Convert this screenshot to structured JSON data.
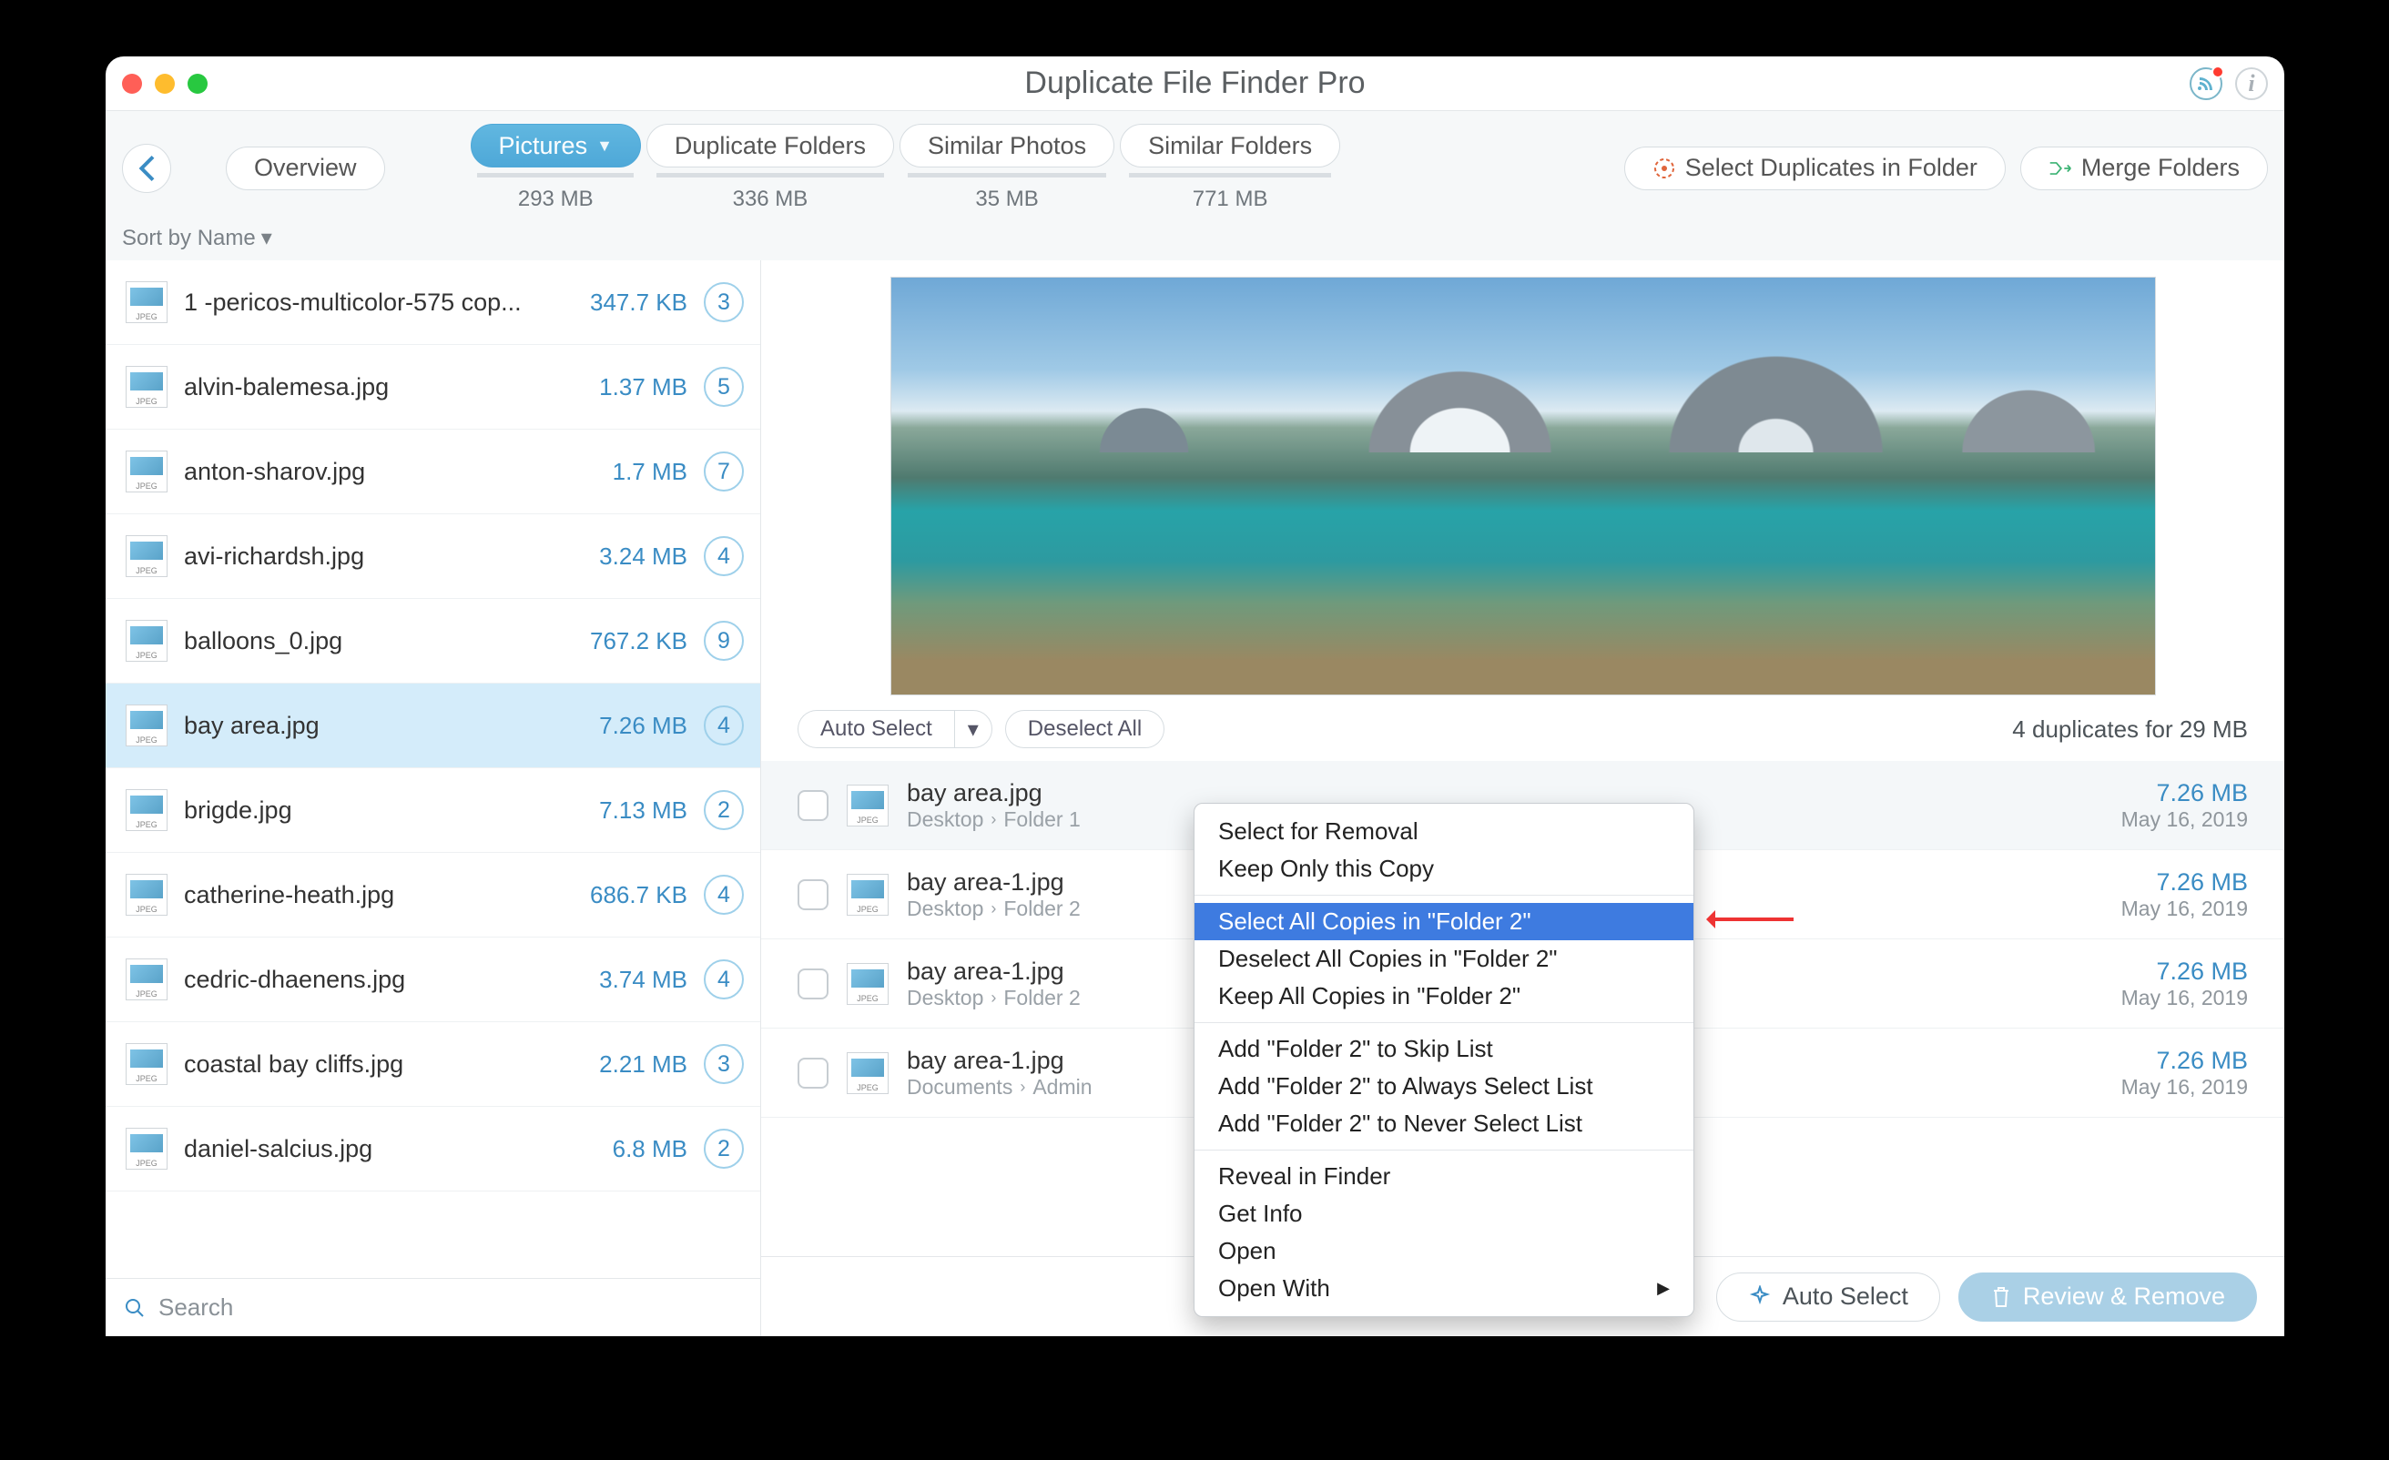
{
  "title": "Duplicate File Finder Pro",
  "toolbar": {
    "overview": "Overview",
    "tabs": [
      {
        "label": "Pictures",
        "size": "293 MB",
        "active": true
      },
      {
        "label": "Duplicate Folders",
        "size": "336 MB",
        "active": false
      },
      {
        "label": "Similar Photos",
        "size": "35 MB",
        "active": false
      },
      {
        "label": "Similar Folders",
        "size": "771 MB",
        "active": false
      }
    ],
    "select_in_folder": "Select Duplicates in Folder",
    "merge_folders": "Merge Folders"
  },
  "sort": {
    "label": "Sort by Name"
  },
  "files": [
    {
      "name": "1 -pericos-multicolor-575 cop...",
      "size": "347.7 KB",
      "count": "3"
    },
    {
      "name": "alvin-balemesa.jpg",
      "size": "1.37 MB",
      "count": "5"
    },
    {
      "name": "anton-sharov.jpg",
      "size": "1.7 MB",
      "count": "7"
    },
    {
      "name": "avi-richardsh.jpg",
      "size": "3.24 MB",
      "count": "4"
    },
    {
      "name": "balloons_0.jpg",
      "size": "767.2 KB",
      "count": "9"
    },
    {
      "name": "bay area.jpg",
      "size": "7.26 MB",
      "count": "4",
      "selected": true
    },
    {
      "name": "brigde.jpg",
      "size": "7.13 MB",
      "count": "2"
    },
    {
      "name": "catherine-heath.jpg",
      "size": "686.7 KB",
      "count": "4"
    },
    {
      "name": "cedric-dhaenens.jpg",
      "size": "3.74 MB",
      "count": "4"
    },
    {
      "name": "coastal bay cliffs.jpg",
      "size": "2.21 MB",
      "count": "3"
    },
    {
      "name": "daniel-salcius.jpg",
      "size": "6.8 MB",
      "count": "2"
    }
  ],
  "search": {
    "placeholder": "Search"
  },
  "detail": {
    "auto_select": "Auto Select",
    "deselect_all": "Deselect All",
    "summary": "4 duplicates for 29 MB",
    "dups": [
      {
        "file": "bay area.jpg",
        "path": [
          "Desktop",
          "Folder 1"
        ],
        "size": "7.26 MB",
        "date": "May 16, 2019"
      },
      {
        "file": "bay area-1.jpg",
        "path": [
          "Desktop",
          "Folder 2"
        ],
        "size": "7.26 MB",
        "date": "May 16, 2019"
      },
      {
        "file": "bay area-1.jpg",
        "path": [
          "Desktop",
          "Folder 2"
        ],
        "size": "7.26 MB",
        "date": "May 16, 2019"
      },
      {
        "file": "bay area-1.jpg",
        "path": [
          "Documents",
          "Admin"
        ],
        "size": "7.26 MB",
        "date": "May 16, 2019"
      }
    ]
  },
  "context_menu": {
    "items": [
      {
        "label": "Select for Removal"
      },
      {
        "label": "Keep Only this Copy"
      },
      {
        "sep": true
      },
      {
        "label": "Select All Copies in \"Folder 2\"",
        "highlight": true
      },
      {
        "label": "Deselect All Copies in \"Folder 2\""
      },
      {
        "label": "Keep All Copies in \"Folder 2\""
      },
      {
        "sep": true
      },
      {
        "label": "Add \"Folder 2\" to Skip List"
      },
      {
        "label": "Add \"Folder 2\" to Always Select List"
      },
      {
        "label": "Add \"Folder 2\" to Never Select List"
      },
      {
        "sep": true
      },
      {
        "label": "Reveal in Finder"
      },
      {
        "label": "Get Info"
      },
      {
        "label": "Open"
      },
      {
        "label": "Open With",
        "submenu": true
      }
    ]
  },
  "footer": {
    "auto_select": "Auto Select",
    "review": "Review & Remove"
  }
}
